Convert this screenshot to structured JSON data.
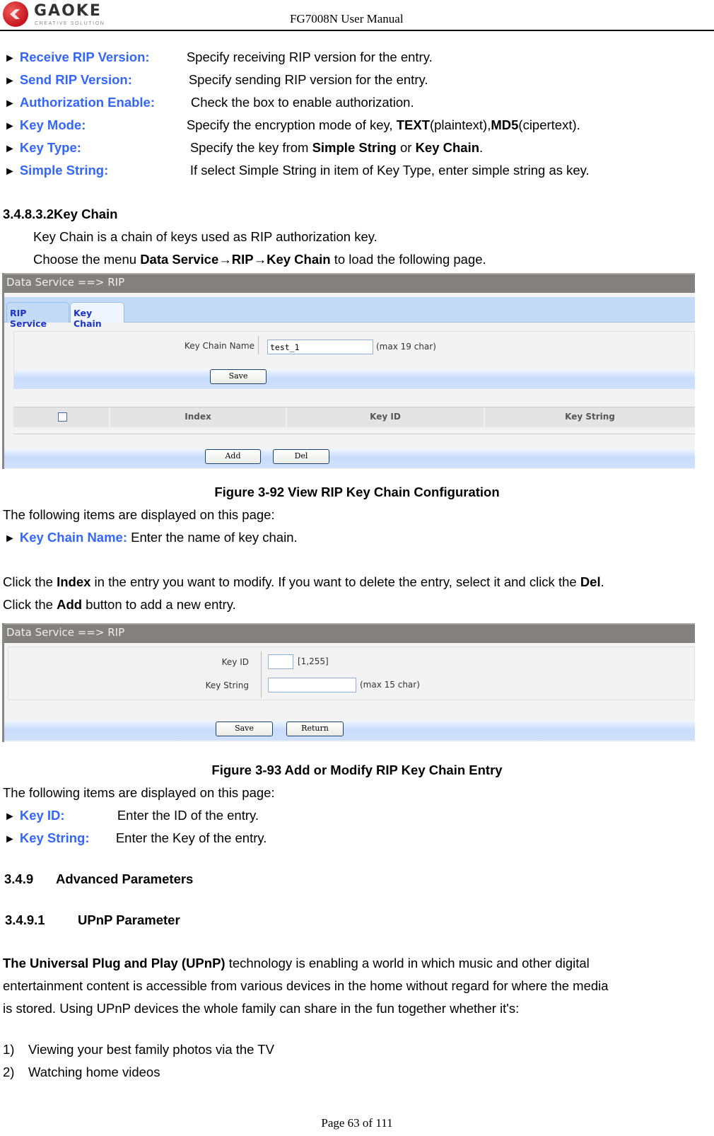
{
  "header": {
    "brand": "GAOKE",
    "brand_tagline": "CREATIVE SOLUTION",
    "doc_title": "FG7008N User Manual"
  },
  "intro_items": [
    {
      "term": "Receive RIP Version:",
      "desc": "Specify receiving RIP version for the entry."
    },
    {
      "term": "Send RIP Version:",
      "desc": "Specify sending RIP version for the entry."
    },
    {
      "term": "Authorization Enable:",
      "desc": "Check the box to enable authorization."
    },
    {
      "term": "Key Mode:",
      "desc_pre": "Specify the encryption mode of key, ",
      "b1": "TEXT",
      "mid": "(plaintext),",
      "b2": "MD5",
      "post": "(cipertext)."
    },
    {
      "term": "Key Type:",
      "desc_pre": "Specify the key from ",
      "b1": "Simple String",
      "mid": " or ",
      "b2": "Key Chain",
      "post": "."
    },
    {
      "term": "Simple String:",
      "desc": "If select Simple String in item of Key Type, enter simple string as key."
    }
  ],
  "section_key_chain": {
    "number": "3.4.8.3.2",
    "title": "Key Chain",
    "para1": "Key Chain is a chain of keys used as RIP authorization key.",
    "para2_pre": "Choose the menu ",
    "para2_bold": "Data Service→RIP→Key Chain",
    "para2_post": " to load the following page."
  },
  "figure92": {
    "title_bar": "Data Service ==> RIP",
    "tabs": [
      {
        "label": "RIP Service",
        "active": false
      },
      {
        "label": "Key Chain",
        "active": true
      }
    ],
    "field_label": "Key Chain Name",
    "field_value": "test_1",
    "field_hint": "(max 19 char)",
    "save_label": "Save",
    "table_headers": [
      "Index",
      "Key ID",
      "Key String"
    ],
    "add_label": "Add",
    "del_label": "Del",
    "caption": "Figure 3-92   View RIP Key Chain Configuration"
  },
  "after92": {
    "items_intro": "The following items are displayed on this page:",
    "item_term": "Key Chain Name:",
    "item_desc": " Enter the name of key chain.",
    "p1_pre": "Click the ",
    "p1_b1": "Index",
    "p1_mid": " in the entry you want to modify. If you want to delete the entry, select it and click the ",
    "p1_b2": "Del",
    "p1_post": ".",
    "p2_pre": "Click the ",
    "p2_b": "Add",
    "p2_post": " button to add a new entry."
  },
  "figure93": {
    "title_bar": "Data Service ==> RIP",
    "key_id_label": "Key ID",
    "key_id_value": "",
    "key_id_hint": "[1,255]",
    "key_string_label": "Key String",
    "key_string_value": "",
    "key_string_hint": "(max 15 char)",
    "save_label": "Save",
    "return_label": "Return",
    "caption": "Figure 3-93   Add or Modify RIP Key Chain Entry"
  },
  "after93": {
    "items_intro": "The following items are displayed on this page:",
    "items": [
      {
        "term": "Key ID:",
        "desc": "Enter the ID of the entry."
      },
      {
        "term": "Key String:",
        "desc": "Enter the Key of the entry."
      }
    ]
  },
  "section_advanced": {
    "number": "3.4.9",
    "title": "Advanced Parameters"
  },
  "section_upnp": {
    "number": "3.4.9.1",
    "title": "UPnP Parameter",
    "para_bold": "The Universal Plug and Play (UPnP)",
    "para_l1": " technology is enabling a world in which music and other digital",
    "para_l2": "entertainment content is accessible from various devices in the home without regard for where the media",
    "para_l3": "is stored. Using UPnP devices the whole family can share in the fun together whether it's:",
    "list": [
      {
        "num": "1)",
        "text": "Viewing your best family photos via the TV"
      },
      {
        "num": "2)",
        "text": "Watching home videos"
      }
    ]
  },
  "footer": {
    "page": "Page 63 of 111"
  }
}
